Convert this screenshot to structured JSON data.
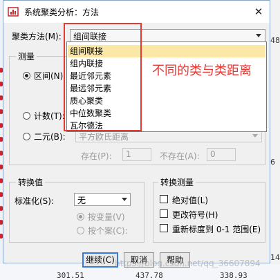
{
  "dialog": {
    "title": "系统聚类分析：方法",
    "close_glyph": "✕"
  },
  "method": {
    "label": "聚类方法(M):",
    "value": "组间联接",
    "options": [
      "组间联接",
      "组内联接",
      "最近邻元素",
      "最远邻元素",
      "质心聚类",
      "中位数聚类",
      "瓦尔德法"
    ],
    "selected_index": 0
  },
  "measure": {
    "title": "测量",
    "interval_label": "区间(N):",
    "counts_label": "计数(T):",
    "binary_label": "二元(B):",
    "binary_measure_value": "平方欧氏距离",
    "present_label": "存在(P):",
    "present_value": "1",
    "absent_label": "不存在(A):",
    "absent_value": "0"
  },
  "transform_values": {
    "title": "转换值",
    "standardize_label": "标准化(S):",
    "standardize_value": "无",
    "by_variable_label": "按变量(V)",
    "by_case_label": "按个案(C):"
  },
  "transform_measures": {
    "title": "转换测量",
    "absolute_label": "绝对值(L)",
    "change_sign_label": "更改符号(H)",
    "rescale_label": "重新标度到 0-1 范围(E)"
  },
  "buttons": {
    "continue": "继续(C)",
    "cancel": "取消",
    "help": "帮助"
  },
  "annotation": {
    "text": "不同的类与类距离"
  },
  "watermark": "https://blog.csdn.net/qq_36607894",
  "background": {
    "bottom_numbers": [
      "301.51",
      "437.78",
      "338.93"
    ],
    "right_numbers": [
      "48",
      "6",
      "14"
    ]
  },
  "colors": {
    "accent_blue": "#3a7bd5",
    "highlight": "#fbe7a6",
    "annotation_red": "#e53935"
  }
}
